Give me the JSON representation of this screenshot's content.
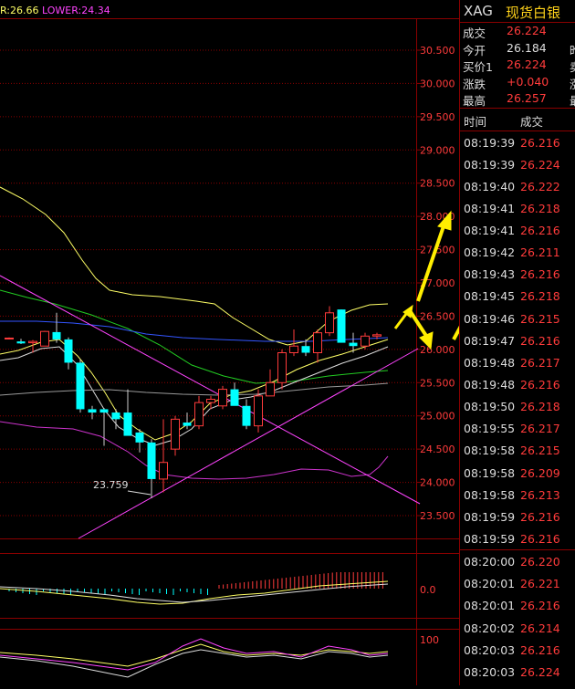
{
  "indicator_legend": {
    "upper": "R:26.66",
    "lower": "LOWER:24.34"
  },
  "price_axis": {
    "labels": [
      "30.500",
      "30.000",
      "29.500",
      "29.000",
      "28.500",
      "28.000",
      "27.500",
      "27.000",
      "26.500",
      "26.000",
      "25.500",
      "25.000",
      "24.500",
      "24.000",
      "23.500"
    ],
    "values": [
      30.5,
      30.0,
      29.5,
      29.0,
      28.5,
      28.0,
      27.5,
      27.0,
      26.5,
      26.0,
      25.5,
      25.0,
      24.5,
      24.0,
      23.5
    ]
  },
  "low_annotation": "23.759",
  "macd_axis_label": "0.0",
  "kdj_axis_label": "100",
  "colors": {
    "up": "#ff3b3b",
    "down": "#00ffff",
    "grid": "#8a0000",
    "axis_text": "#ff3b3b",
    "arrow": "#ffee00",
    "boll_mid": "#ffff66",
    "boll_lower": "#cc33cc",
    "ma_green": "#22cc22",
    "ma_blue": "#3355ff"
  },
  "chart_data": {
    "type": "candlestick",
    "series": [
      {
        "name": "candles",
        "ohlc": [
          [
            26.16,
            26.18,
            26.15,
            26.17
          ],
          [
            26.12,
            26.16,
            26.08,
            26.09
          ],
          [
            26.1,
            26.14,
            25.95,
            26.12
          ],
          [
            26.05,
            26.28,
            26.05,
            26.27
          ],
          [
            26.26,
            26.55,
            26.1,
            26.15
          ],
          [
            26.15,
            26.18,
            25.7,
            25.8
          ],
          [
            25.8,
            25.85,
            25.05,
            25.1
          ],
          [
            25.1,
            25.15,
            24.95,
            25.05
          ],
          [
            25.1,
            25.12,
            24.55,
            25.05
          ],
          [
            25.05,
            25.1,
            24.8,
            24.95
          ],
          [
            25.05,
            25.4,
            24.75,
            24.7
          ],
          [
            24.75,
            24.8,
            24.45,
            24.6
          ],
          [
            24.6,
            24.65,
            23.76,
            24.05
          ],
          [
            24.05,
            24.95,
            23.85,
            24.3
          ],
          [
            24.5,
            25.0,
            24.4,
            24.95
          ],
          [
            24.9,
            25.05,
            24.8,
            24.85
          ],
          [
            24.85,
            25.3,
            24.8,
            25.2
          ],
          [
            25.2,
            25.3,
            25.1,
            25.25
          ],
          [
            25.15,
            25.45,
            25.1,
            25.4
          ],
          [
            25.4,
            25.5,
            25.25,
            25.15
          ],
          [
            25.15,
            25.25,
            24.8,
            24.85
          ],
          [
            24.85,
            25.4,
            24.75,
            25.3
          ],
          [
            25.3,
            25.7,
            25.3,
            25.5
          ],
          [
            25.5,
            26.0,
            25.4,
            25.95
          ],
          [
            25.95,
            26.3,
            25.9,
            26.05
          ],
          [
            26.05,
            26.15,
            25.9,
            25.95
          ],
          [
            25.95,
            26.3,
            25.8,
            26.25
          ],
          [
            26.25,
            26.65,
            26.2,
            26.55
          ],
          [
            26.6,
            26.6,
            26.15,
            26.1
          ],
          [
            26.1,
            26.25,
            25.95,
            26.05
          ],
          [
            26.05,
            26.25,
            26.0,
            26.2
          ],
          [
            26.2,
            26.25,
            26.15,
            26.22
          ]
        ]
      }
    ]
  },
  "panel": {
    "symbol": "XAG",
    "name": "现货白银",
    "quote_rows": [
      {
        "key": "成交",
        "value": "26.224",
        "extra": ""
      },
      {
        "key": "今开",
        "value": "26.184",
        "extra": "昨"
      },
      {
        "key": "买价1",
        "value": "26.224",
        "extra": "卖"
      },
      {
        "key": "涨跌",
        "value": "+0.040",
        "extra": "涨"
      },
      {
        "key": "最高",
        "value": "26.257",
        "extra": "最"
      }
    ],
    "trades_header": {
      "time": "时间",
      "price": "成交"
    },
    "trades_a": [
      {
        "time": "08:19:39",
        "price": "26.216"
      },
      {
        "time": "08:19:39",
        "price": "26.224"
      },
      {
        "time": "08:19:40",
        "price": "26.222"
      },
      {
        "time": "08:19:41",
        "price": "26.218"
      },
      {
        "time": "08:19:41",
        "price": "26.216"
      },
      {
        "time": "08:19:42",
        "price": "26.211"
      },
      {
        "time": "08:19:43",
        "price": "26.216"
      },
      {
        "time": "08:19:45",
        "price": "26.218"
      },
      {
        "time": "08:19:46",
        "price": "26.215"
      },
      {
        "time": "08:19:47",
        "price": "26.216"
      },
      {
        "time": "08:19:48",
        "price": "26.217"
      },
      {
        "time": "08:19:48",
        "price": "26.216"
      },
      {
        "time": "08:19:50",
        "price": "26.218"
      },
      {
        "time": "08:19:55",
        "price": "26.217"
      },
      {
        "time": "08:19:58",
        "price": "26.215"
      },
      {
        "time": "08:19:58",
        "price": "26.209"
      },
      {
        "time": "08:19:58",
        "price": "26.213"
      },
      {
        "time": "08:19:59",
        "price": "26.216"
      },
      {
        "time": "08:19:59",
        "price": "26.216"
      }
    ],
    "trades_b": [
      {
        "time": "08:20:00",
        "price": "26.220"
      },
      {
        "time": "08:20:01",
        "price": "26.221"
      },
      {
        "time": "08:20:01",
        "price": "26.216"
      },
      {
        "time": "08:20:02",
        "price": "26.214"
      },
      {
        "time": "08:20:03",
        "price": "26.216"
      },
      {
        "time": "08:20:03",
        "price": "26.224"
      }
    ]
  }
}
